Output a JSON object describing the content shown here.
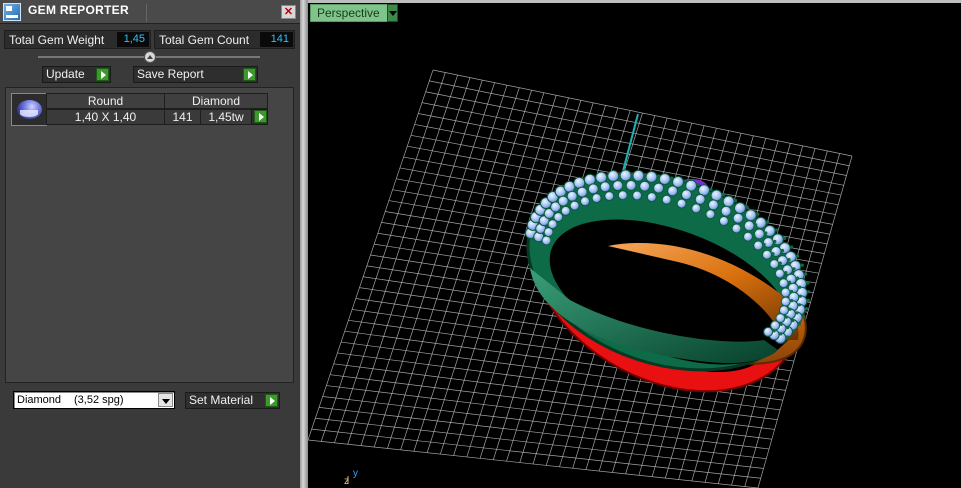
{
  "panel": {
    "title": "GEM REPORTER",
    "close_symbol": "✕",
    "total_gem_weight_label": "Total Gem Weight",
    "total_gem_weight_value": "1,45",
    "total_gem_count_label": "Total Gem Count",
    "total_gem_count_value": "141",
    "update_label": "Update",
    "save_report_label": "Save Report",
    "gem_rows": [
      {
        "thumb_icon": "round-gem-icon",
        "shape_header": "Round",
        "material_header": "Diamond",
        "size": "1,40 X 1,40",
        "count": "141",
        "weight": "1,45tw"
      }
    ],
    "material": {
      "name": "Diamond",
      "spg": "(3,52 spg)"
    },
    "set_material_label": "Set Material"
  },
  "viewport": {
    "view_name": "Perspective",
    "axis_labels": {
      "y": "y",
      "z": "z"
    }
  },
  "colors": {
    "panel_bg": "#3a3a3a",
    "value_text": "#27c4ff",
    "play_button": "#3c9a2c",
    "view_label_bg": "#7fc58a",
    "grid": "#bfbfbf",
    "ring_red": "#e81010",
    "ring_orange": "#e07a10",
    "ring_green": "#127a55",
    "gems": "#a9c8ff"
  }
}
